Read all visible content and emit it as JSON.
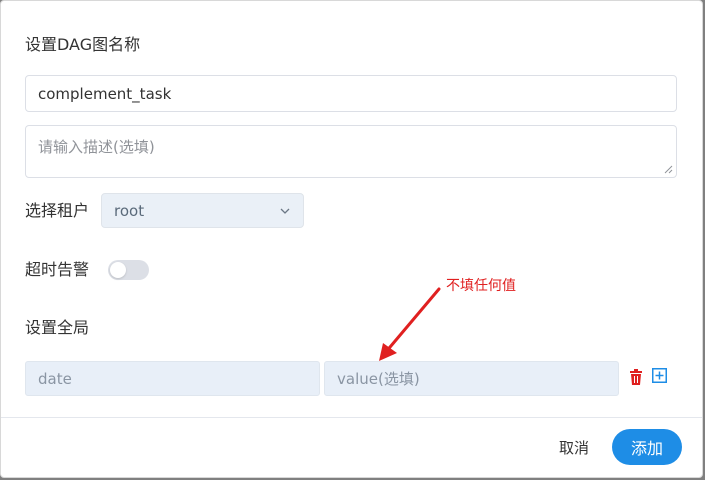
{
  "dialog": {
    "name_section_title": "设置DAG图名称",
    "name_value": "complement_task",
    "description_placeholder": "请输入描述(选填)",
    "tenant_label": "选择租户",
    "tenant_value": "root",
    "timeout_label": "超时告警",
    "timeout_enabled": false,
    "global_section_title": "设置全局",
    "global_params": [
      {
        "key": "date",
        "value_placeholder": "value(选填)"
      }
    ],
    "annotation_text": "不填任何值",
    "cancel_label": "取消",
    "add_label": "添加"
  },
  "colors": {
    "primary": "#1e8de6",
    "danger": "#e02020",
    "annotation": "#e02020"
  },
  "icons": {
    "select_chevron": "chevron-down-icon",
    "delete": "trash-icon",
    "add": "plus-square-icon",
    "resize": "resize-handle-icon",
    "arrow": "annotation-arrow"
  }
}
